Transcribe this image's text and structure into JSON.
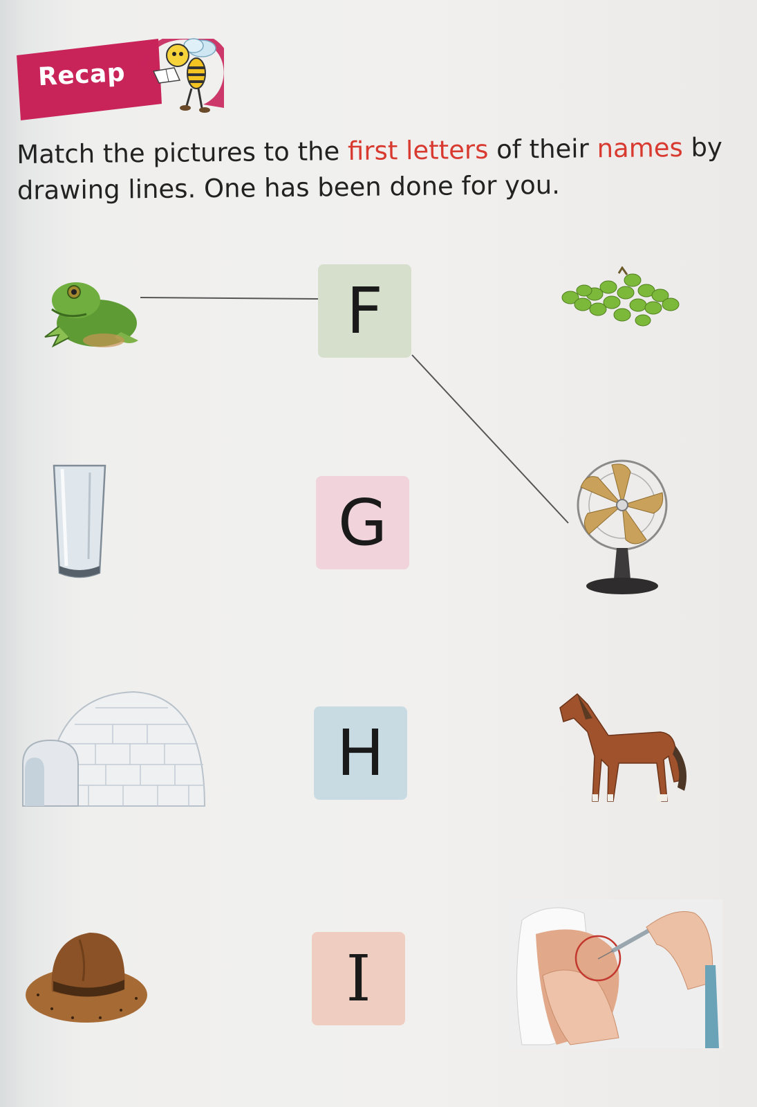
{
  "header": {
    "badge_label": "Recap"
  },
  "instructions": {
    "part1": "Match the pictures to the ",
    "highlight1": "first letters",
    "part2": " of their ",
    "highlight2": "names",
    "part3": " by drawing lines. One has been done for you."
  },
  "letters": [
    "F",
    "G",
    "H",
    "I"
  ],
  "left_pictures": [
    "frog",
    "glass",
    "igloo",
    "hat"
  ],
  "right_pictures": [
    "grapes",
    "fan",
    "horse",
    "injection"
  ],
  "colors": {
    "banner": "#c8245a",
    "highlight": "#d93a30"
  }
}
